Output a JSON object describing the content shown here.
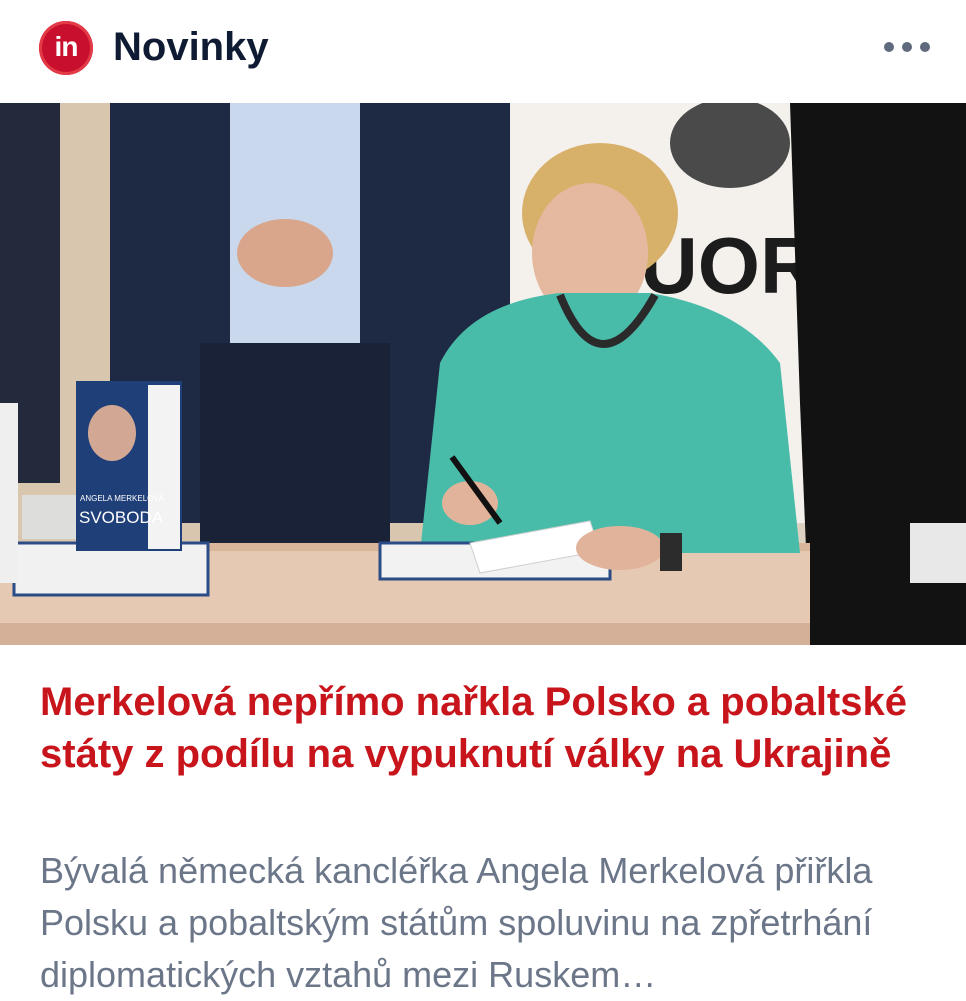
{
  "header": {
    "logo_text": "in",
    "source_name": "Novinky",
    "more_icon": "more-horizontal-icon"
  },
  "article": {
    "image_alt": "Angela Merkel signing a copy of her book SVOBODA at a table",
    "book_cover_author": "ANGELA MERKELOVÁ",
    "book_cover_title": "SVOBODA",
    "backdrop_text": "UOR",
    "headline": "Merkelová nepřímo nařkla Polsko a pobaltské státy z podílu na vypuknutí války na Ukrajině",
    "summary": "Bývalá německá kancléřka Angela Merkelová přiřkla Polsku a pobaltským státům spoluvinu na zpřetrhání diplomatických vztahů mezi Ruskem…"
  },
  "colors": {
    "brand_red": "#c8102e",
    "headline_red": "#c8151c",
    "summary_gray": "#6b7689",
    "title_navy": "#0f1b33"
  }
}
